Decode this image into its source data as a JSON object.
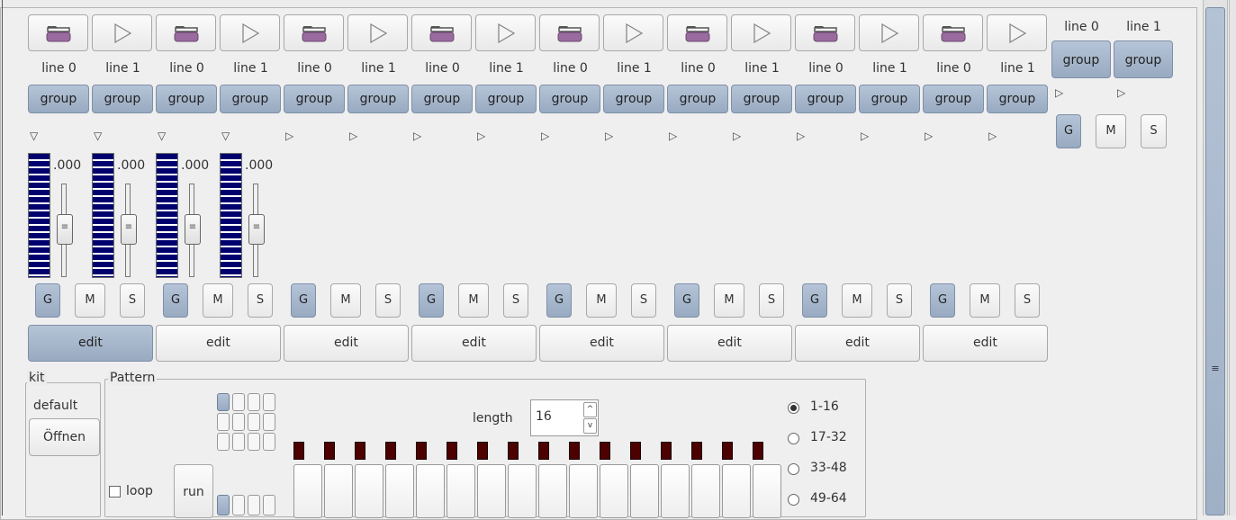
{
  "tracks": {
    "line0_label": "line 0",
    "line1_label": "line 1",
    "group_label": "group"
  },
  "master": {
    "line0_label": "line 0",
    "line1_label": "line 1",
    "group_label": "group",
    "g_label": "G",
    "m_label": "M",
    "s_label": "S"
  },
  "strips": {
    "volume_value": ".000",
    "g_label": "G",
    "m_label": "M",
    "s_label": "S",
    "edit_label": "edit"
  },
  "kit": {
    "legend": "kit",
    "name": "default",
    "open_label": "Öffnen"
  },
  "pattern": {
    "legend": "Pattern",
    "length_label": "length",
    "length_value": "16",
    "loop_label": "loop",
    "run_label": "run",
    "ranges": [
      "1-16",
      "17-32",
      "33-48",
      "49-64"
    ],
    "selected_range": "1-16"
  },
  "colors": {
    "accent_blue": "#9fb0c6",
    "meter_blue": "#00006e",
    "led_red": "#4d0000",
    "folder_purple": "#9a6b9e"
  },
  "icons": {
    "open": "folder-icon",
    "play": "play-triangle-icon",
    "expanded": "triangle-down-icon",
    "collapsed": "triangle-right-icon"
  }
}
